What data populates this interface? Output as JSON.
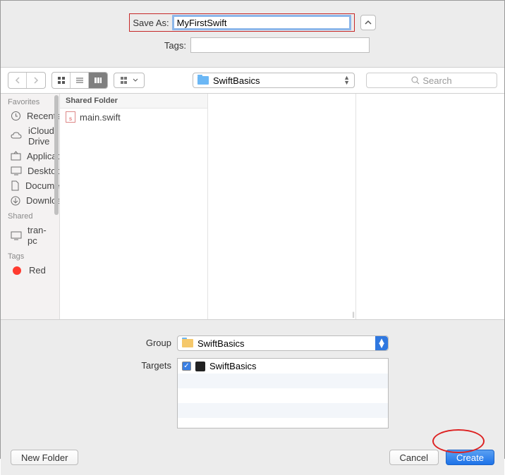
{
  "saveAs": {
    "label": "Save As:",
    "value": "MyFirstSwift"
  },
  "tags": {
    "label": "Tags:",
    "value": ""
  },
  "path": {
    "current": "SwiftBasics"
  },
  "search": {
    "placeholder": "Search"
  },
  "sidebar": {
    "sections": [
      {
        "title": "Favorites",
        "items": [
          {
            "icon": "clock",
            "label": "Recents"
          },
          {
            "icon": "cloud",
            "label": "iCloud Drive"
          },
          {
            "icon": "apps",
            "label": "Applications"
          },
          {
            "icon": "desktop",
            "label": "Desktop"
          },
          {
            "icon": "doc",
            "label": "Documents"
          },
          {
            "icon": "download",
            "label": "Downloads"
          }
        ]
      },
      {
        "title": "Shared",
        "items": [
          {
            "icon": "display",
            "label": "tran-pc"
          }
        ]
      },
      {
        "title": "Tags",
        "items": [
          {
            "icon": "reddot",
            "label": "Red"
          }
        ]
      }
    ]
  },
  "columnHeader": "Shared Folder",
  "files": [
    {
      "name": "main.swift"
    }
  ],
  "group": {
    "label": "Group",
    "value": "SwiftBasics"
  },
  "targets": {
    "label": "Targets",
    "items": [
      {
        "checked": true,
        "name": "SwiftBasics"
      }
    ]
  },
  "buttons": {
    "newFolder": "New Folder",
    "cancel": "Cancel",
    "create": "Create"
  }
}
